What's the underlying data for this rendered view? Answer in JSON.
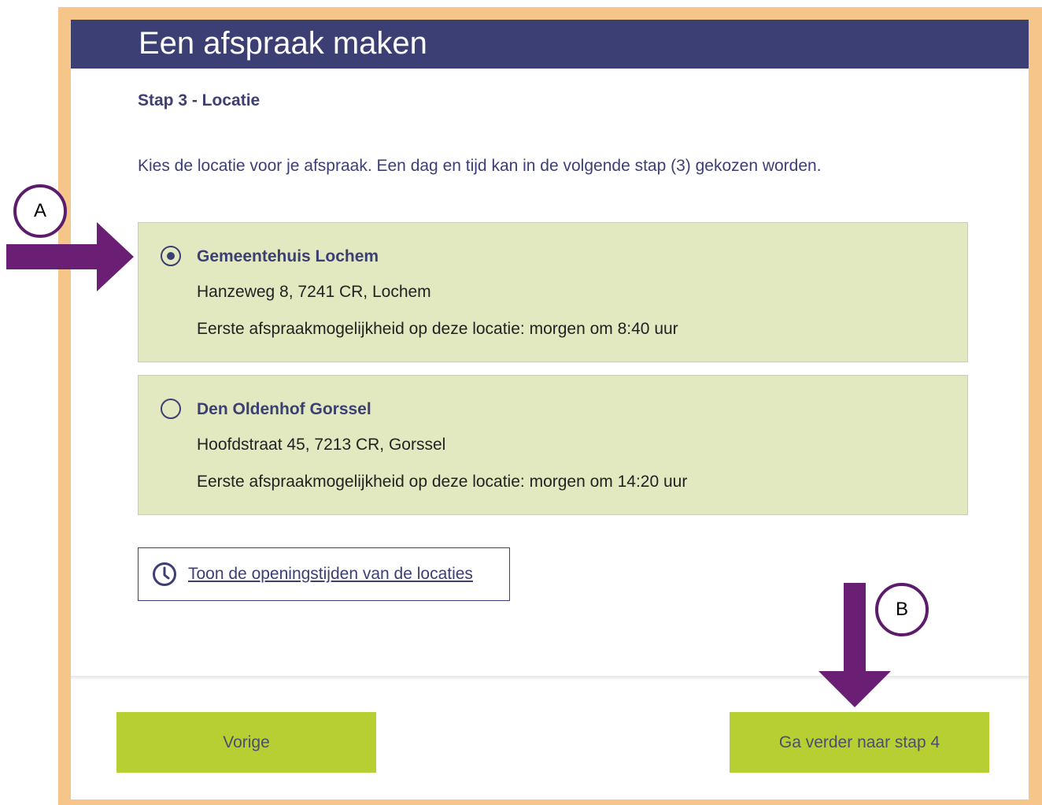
{
  "header": {
    "title": "Een afspraak maken"
  },
  "step": {
    "title": "Stap 3 - Locatie"
  },
  "intro": "Kies de locatie voor je afspraak. Een dag en tijd kan in de volgende stap (3) gekozen worden.",
  "locations": [
    {
      "name": "Gemeentehuis Lochem",
      "address": "Hanzeweg 8, 7241 CR, Lochem",
      "first_available": "Eerste afspraakmogelijkheid op deze locatie: morgen om 8:40 uur",
      "selected": true
    },
    {
      "name": "Den Oldenhof Gorssel",
      "address": "Hoofdstraat 45, 7213 CR, Gorssel",
      "first_available": "Eerste afspraakmogelijkheid op deze locatie: morgen om 14:20 uur",
      "selected": false
    }
  ],
  "hours_link": {
    "label": "Toon de openingstijden van de locaties",
    "icon": "clock-icon"
  },
  "buttons": {
    "previous": "Vorige",
    "next": "Ga verder naar stap 4"
  },
  "annotations": {
    "marker_a": "A",
    "marker_b": "B"
  },
  "colors": {
    "header_bg": "#3b3f73",
    "frame": "#f5c58a",
    "card_bg": "#e2e8c0",
    "button_bg": "#b8cf33",
    "arrow": "#6a1f75"
  }
}
